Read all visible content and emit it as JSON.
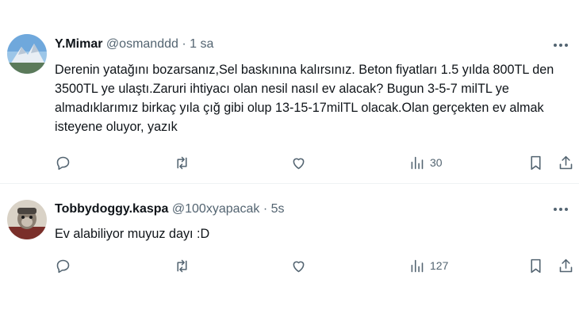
{
  "tweets": [
    {
      "name": "Y.Mimar",
      "handle": "@osmanddd",
      "separator": "·",
      "time": "1 sa",
      "text": "Derenin yatağını bozarsanız,Sel baskınına kalırsınız. Beton fiyatları 1.5 yılda 800TL den 3500TL ye ulaştı.Zaruri ihtiyacı olan nesil nasıl ev alacak? Bugun 3-5-7 milTL ye almadıklarımız birkaç yıla çığ gibi olup 13-15-17milTL olacak.Olan gerçekten ev almak isteyene oluyor, yazık",
      "views": "30",
      "icons": [
        "reply-icon",
        "retweet-icon",
        "like-icon",
        "views-icon",
        "bookmark-icon",
        "share-icon",
        "more-icon"
      ]
    },
    {
      "name": "Tobbydoggy.kaspa",
      "handle": "@100xyapacak",
      "separator": "·",
      "time": "5s",
      "text": "Ev alabiliyor muyuz dayı :D",
      "views": "127",
      "icons": [
        "reply-icon",
        "retweet-icon",
        "like-icon",
        "views-icon",
        "bookmark-icon",
        "share-icon",
        "more-icon"
      ]
    }
  ],
  "colors": {
    "text": "#0f1419",
    "muted": "#536471",
    "divider": "#eff3f4"
  }
}
